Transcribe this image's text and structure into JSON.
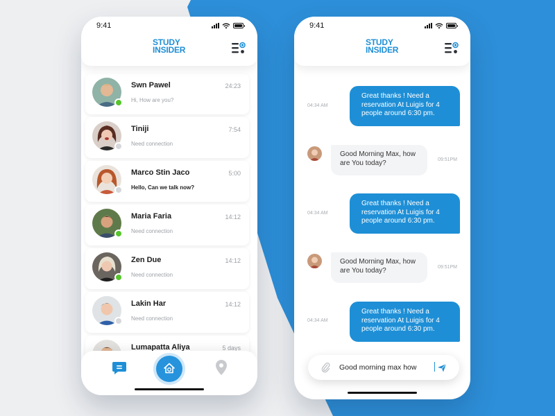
{
  "status": {
    "time": "9:41"
  },
  "brand": {
    "line1": "STUDY",
    "line2": "INSIDER",
    "color": "#1e8fd6"
  },
  "colors": {
    "online": "#56c42c",
    "offline": "#d6d7da",
    "accent": "#1e8fd6",
    "background_blue": "#2d8fd9"
  },
  "chats": [
    {
      "name": "Swn Pawel",
      "time": "24:23",
      "preview": "Hi, How are you?",
      "status": "online",
      "unread": false
    },
    {
      "name": "Tiniji",
      "time": "7:54",
      "preview": "Need connection",
      "status": "offline",
      "unread": false
    },
    {
      "name": "Marco Stin Jaco",
      "time": "5:00",
      "preview": "Hello, Can we talk now?",
      "status": "offline",
      "unread": true
    },
    {
      "name": "Maria Faria",
      "time": "14:12",
      "preview": "Need connection",
      "status": "online",
      "unread": false
    },
    {
      "name": "Zen Due",
      "time": "14:12",
      "preview": "Need connection",
      "status": "online",
      "unread": false
    },
    {
      "name": "Lakin Har",
      "time": "14:12",
      "preview": "Need connection",
      "status": "offline",
      "unread": false
    },
    {
      "name": "Lumapatta Aliya",
      "time": "5 days",
      "preview": "",
      "status": "offline",
      "unread": false
    }
  ],
  "nav": {
    "items": [
      "chat-icon",
      "home-icon",
      "location-pin-icon"
    ]
  },
  "messages": [
    {
      "direction": "out",
      "time": "04:34 AM",
      "text": "Great thanks ! Need a reservation  At Luigis for 4 people around 6:30 pm."
    },
    {
      "direction": "in",
      "time": "09:51PM",
      "text": "Good Morning Max, how are You today?"
    },
    {
      "direction": "out",
      "time": "04:34 AM",
      "text": "Great thanks ! Need a reservation  At Luigis for 4 people around 6:30 pm."
    },
    {
      "direction": "in",
      "time": "09:51PM",
      "text": "Good Morning Max, how are You today?"
    },
    {
      "direction": "out",
      "time": "04:34 AM",
      "text": "Great thanks ! Need a reservation  At Luigis for 4 people around 6:30 pm."
    }
  ],
  "composer": {
    "value": "Good morning max how"
  }
}
